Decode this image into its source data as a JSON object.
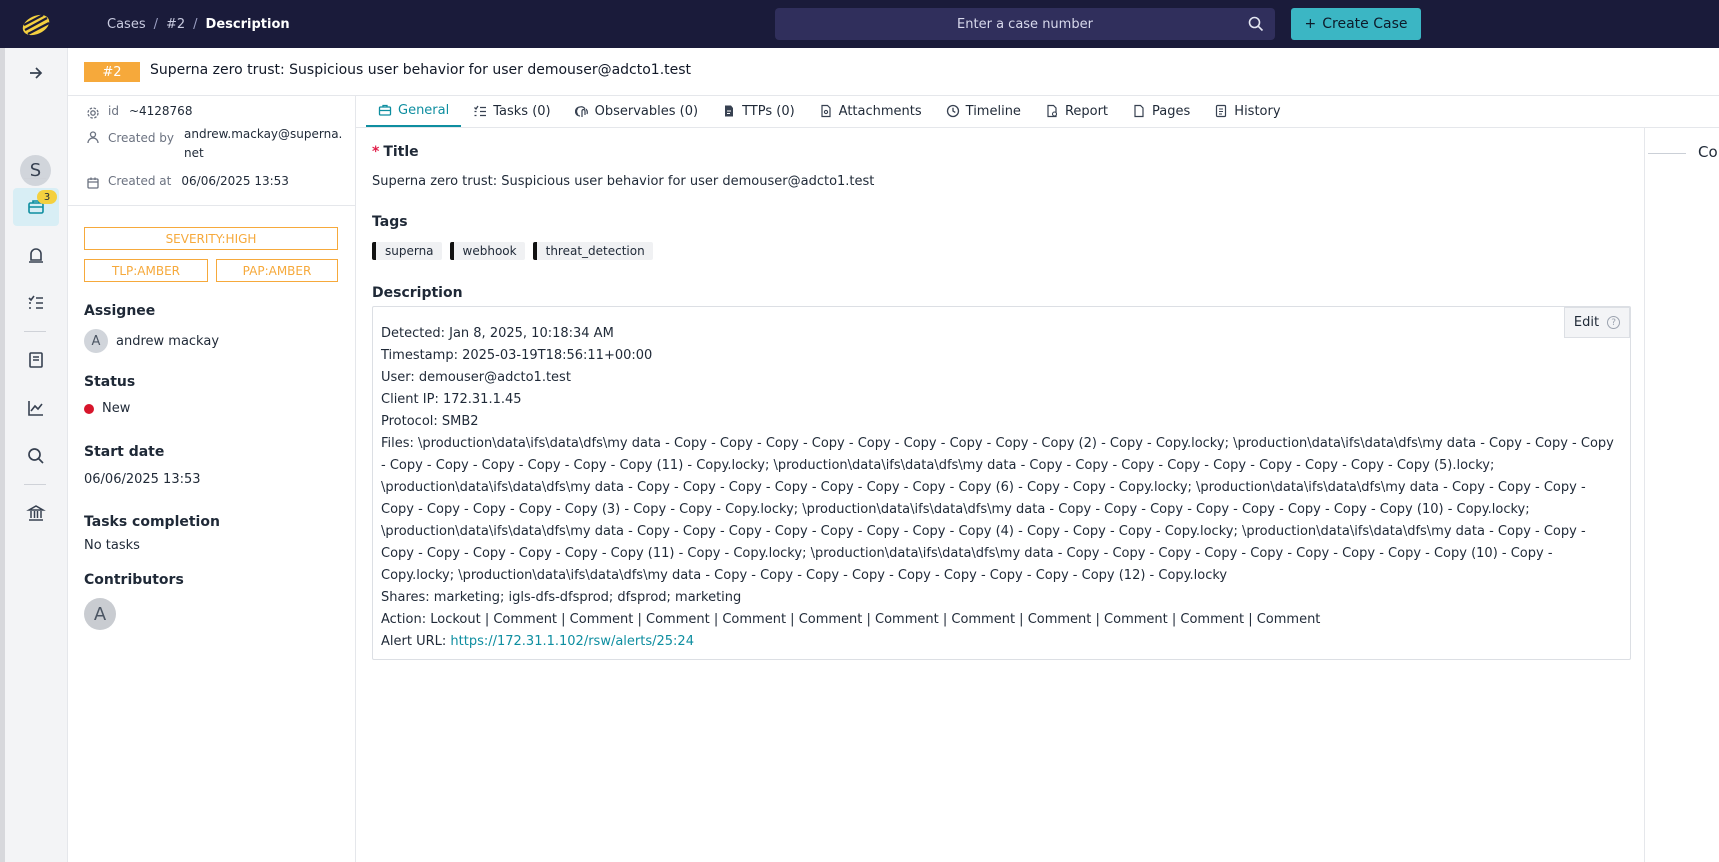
{
  "topbar": {
    "breadcrumb": [
      "Cases",
      "#2",
      "Description"
    ],
    "breadcrumb_sep": "/",
    "search_placeholder": "Enter a case number",
    "create_button": "Create Case",
    "create_button_icon": "+"
  },
  "nav": {
    "avatar_initial": "S",
    "cases_badge": "3"
  },
  "case": {
    "number_badge": "#2",
    "title": "Superna zero trust: Suspicious user behavior for user demouser@adcto1.test"
  },
  "details": {
    "id_label": "id",
    "id_value": "~4128768",
    "created_by_label": "Created by",
    "created_by_value_line1": "andrew.mackay@superna.",
    "created_by_value_line2": "net",
    "created_at_label": "Created at",
    "created_at_value": "06/06/2025 13:53",
    "severity": "SEVERITY:HIGH",
    "tlp": "TLP:AMBER",
    "pap": "PAP:AMBER",
    "assignee_label": "Assignee",
    "assignee_initial": "A",
    "assignee_name": "andrew mackay",
    "status_label": "Status",
    "status_value": "New",
    "start_date_label": "Start date",
    "start_date_value": "06/06/2025 13:53",
    "tasks_completion_label": "Tasks completion",
    "tasks_completion_value": "No tasks",
    "contributors_label": "Contributors",
    "contributor_initial": "A",
    "colors": {
      "accent": "#0e8ea0",
      "amber": "#f6a93b",
      "status_new": "#d7152b"
    }
  },
  "tabs": [
    {
      "label": "General",
      "icon": "briefcase-icon",
      "active": true
    },
    {
      "label": "Tasks (0)",
      "icon": "tasks-icon"
    },
    {
      "label": "Observables (0)",
      "icon": "fingerprint-icon"
    },
    {
      "label": "TTPs (0)",
      "icon": "ttp-icon"
    },
    {
      "label": "Attachments",
      "icon": "file-attachment-icon"
    },
    {
      "label": "Timeline",
      "icon": "clock-icon"
    },
    {
      "label": "Report",
      "icon": "report-icon"
    },
    {
      "label": "Pages",
      "icon": "page-icon"
    },
    {
      "label": "History",
      "icon": "history-icon"
    }
  ],
  "general": {
    "title_label": "Title",
    "title_required_mark": "*",
    "title_value": "Superna zero trust: Suspicious user behavior for user demouser@adcto1.test",
    "tags_label": "Tags",
    "tags": [
      "superna",
      "webhook",
      "threat_detection"
    ],
    "description_label": "Description",
    "edit_button": "Edit",
    "help_glyph": "?",
    "description_lines": [
      "Detected: Jan 8, 2025, 10:18:34 AM",
      "Timestamp: 2025-03-19T18:56:11+00:00",
      "User: demouser@adcto1.test",
      "Client IP: 172.31.1.45",
      "Protocol: SMB2",
      "Files: \\production\\data\\ifs\\data\\dfs\\my data - Copy - Copy - Copy - Copy - Copy - Copy - Copy - Copy - Copy (2) - Copy - Copy.locky; \\production\\data\\ifs\\data\\dfs\\my data - Copy - Copy - Copy - Copy - Copy - Copy - Copy - Copy - Copy (11) - Copy.locky; \\production\\data\\ifs\\data\\dfs\\my data - Copy - Copy - Copy - Copy - Copy - Copy - Copy - Copy - Copy (5).locky; \\production\\data\\ifs\\data\\dfs\\my data - Copy - Copy - Copy - Copy - Copy - Copy - Copy - Copy (6) - Copy - Copy - Copy.locky; \\production\\data\\ifs\\data\\dfs\\my data - Copy - Copy - Copy - Copy - Copy - Copy - Copy - Copy (3) - Copy - Copy - Copy.locky; \\production\\data\\ifs\\data\\dfs\\my data - Copy - Copy - Copy - Copy - Copy - Copy - Copy - Copy (10) - Copy.locky; \\production\\data\\ifs\\data\\dfs\\my data - Copy - Copy - Copy - Copy - Copy - Copy - Copy - Copy (4) - Copy - Copy - Copy - Copy.locky; \\production\\data\\ifs\\data\\dfs\\my data - Copy - Copy - Copy - Copy - Copy - Copy - Copy - Copy (11) - Copy - Copy.locky; \\production\\data\\ifs\\data\\dfs\\my data - Copy - Copy - Copy - Copy - Copy - Copy - Copy - Copy - Copy (10) - Copy - Copy.locky; \\production\\data\\ifs\\data\\dfs\\my data - Copy - Copy - Copy - Copy - Copy - Copy - Copy - Copy - Copy (12) - Copy.locky",
      "Shares: marketing; igls-dfs-dfsprod; dfsprod; marketing",
      "Action: Lockout | Comment | Comment | Comment | Comment | Comment | Comment | Comment | Comment | Comment | Comment | Comment"
    ],
    "alert_url_label": "Alert URL: ",
    "alert_url": "https://172.31.1.102/rsw/alerts/25:24"
  },
  "right_panel": {
    "label": "Co"
  }
}
